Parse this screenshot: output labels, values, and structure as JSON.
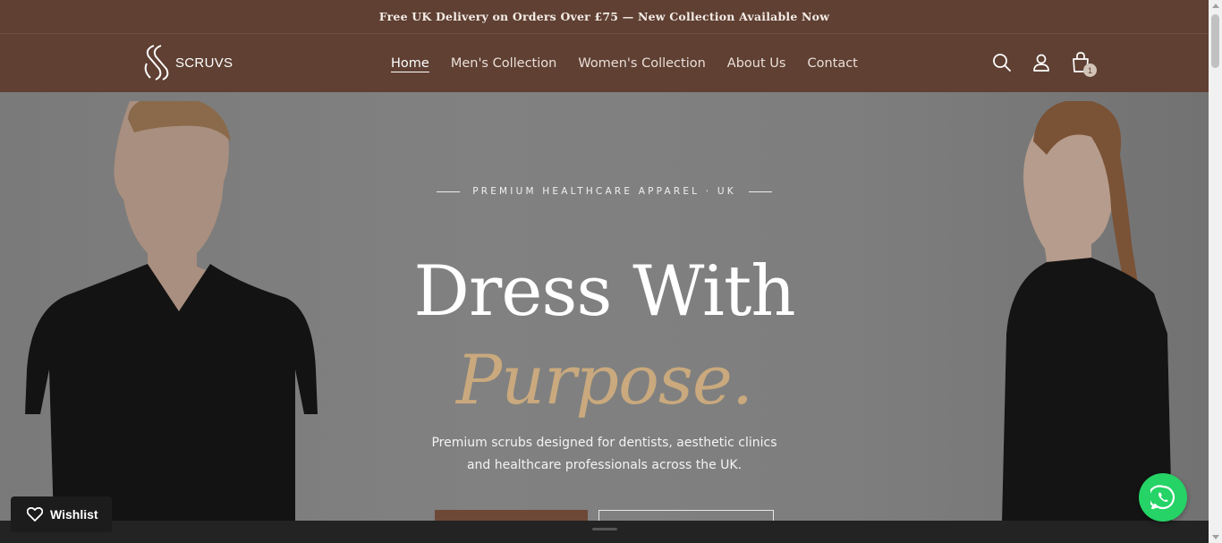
{
  "announcement": {
    "text": "Free UK Delivery on Orders Over £75 — New Collection Available Now"
  },
  "header": {
    "logo_text": "SCRUVS",
    "nav": [
      {
        "label": "Home",
        "active": true
      },
      {
        "label": "Men's Collection"
      },
      {
        "label": "Women's Collection"
      },
      {
        "label": "About Us"
      },
      {
        "label": "Contact"
      }
    ],
    "icons": {
      "search": "search-icon",
      "account": "user-icon",
      "cart": "shopping-bag-icon"
    },
    "cart_count": "1"
  },
  "hero": {
    "eyebrow": "PREMIUM HEALTHCARE APPAREL · UK",
    "heading_line1": "Dress With",
    "heading_line2": "Purpose.",
    "subtext_line1": "Premium scrubs designed for dentists, aesthetic clinics",
    "subtext_line2": "and healthcare professionals across the UK."
  },
  "wishlist": {
    "label": "Wishlist"
  },
  "colors": {
    "brand_brown": "#5f4033",
    "accent_gold": "#c9a97d",
    "whatsapp_green": "#25d366"
  }
}
